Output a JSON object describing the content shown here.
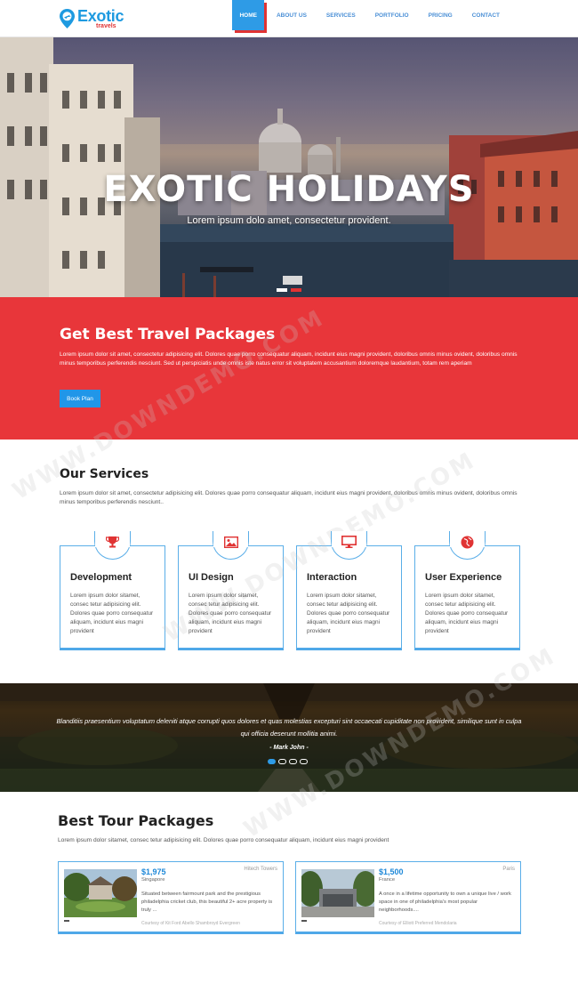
{
  "brand": {
    "name": "Exotic",
    "sub": "travels",
    "color": "#1e9ae0",
    "accent": "#e03333"
  },
  "nav": {
    "items": [
      {
        "label": "HOME",
        "active": true
      },
      {
        "label": "ABOUT US",
        "active": false
      },
      {
        "label": "SERVICES",
        "active": false
      },
      {
        "label": "PORTFOLIO",
        "active": false
      },
      {
        "label": "PRICING",
        "active": false
      },
      {
        "label": "CONTACT",
        "active": false
      }
    ]
  },
  "hero": {
    "title": "EXOTIC HOLIDAYS",
    "subtitle": "Lorem ipsum dolo amet, consectetur provident.",
    "slides": 2,
    "active_slide": 1
  },
  "packages_band": {
    "title": "Get Best Travel Packages",
    "text": "Lorem ipsum dolor sit amet, consectetur adipisicing elit. Dolores quae porro consequatur aliquam, incidunt eius magni provident, doloribus omnis minus ovident, doloribus omnis minus temporibus perferendis nesciunt. Sed ut perspiciatis unde omnis iste natus error sit voluptatem accusantium doloremque laudantium, totam rem aperiam",
    "button": "Book Plan",
    "color": "#e8363a"
  },
  "services": {
    "title": "Our Services",
    "text": "Lorem ipsum dolor sit amet, consectetur adipisicing elit. Dolores quae porro consequatur aliquam, incidunt eius magni provident, doloribus omnis minus ovident, doloribus omnis minus temporibus perferendis nesciunt..",
    "cards": [
      {
        "icon": "trophy-icon",
        "title": "Development",
        "text": "Lorem ipsum dolor sitamet, consec tetur adipisicing elit. Dolores quae porro consequatur aliquam, incidunt eius magni provident"
      },
      {
        "icon": "picture-icon",
        "title": "UI Design",
        "text": "Lorem ipsum dolor sitamet, consec tetur adipisicing elit. Dolores quae porro consequatur aliquam, incidunt eius magni provident"
      },
      {
        "icon": "monitor-icon",
        "title": "Interaction",
        "text": "Lorem ipsum dolor sitamet, consec tetur adipisicing elit. Dolores quae porro consequatur aliquam, incidunt eius magni provident"
      },
      {
        "icon": "globe-icon",
        "title": "User Experience",
        "text": "Lorem ipsum dolor sitamet, consec tetur adipisicing elit. Dolores quae porro consequatur aliquam, incidunt eius magni provident"
      }
    ]
  },
  "testimonial": {
    "quote": "Blanditiis praesentium voluptatum deleniti atque corrupti quos dolores et quas molestias excepturi sint occaecati cupiditate non provident, similique sunt in culpa qui officia deserunt mollitia animi.",
    "author": "- Mark John -",
    "dots": 4,
    "active_dot": 0
  },
  "tours": {
    "title": "Best Tour Packages",
    "text": "Lorem ipsum dolor sitamet, consec tetur adipisicing elit. Dolores quae porro consequatur aliquam, incidunt eius magni provident",
    "items": [
      {
        "price": "$1,975",
        "place": "Hitech Towers",
        "city": "Singapore",
        "desc": "Situated between fairmount park and the prestigious philadelphia cricket club, this beautiful 2+ acre property is truly ...",
        "credit": "Courtesy of Kit Ford Abello Shambroyd Evergreen"
      },
      {
        "price": "$1,500",
        "place": "Paris",
        "city": "France",
        "desc": "A once in a lifetime opportunity to own a unique live / work space in one of philadelphia's most popular neighborhoods....",
        "credit": "Courtesy of Elliott Preferred Mendolaria"
      }
    ]
  },
  "watermark": "WWW.DOWNDEMO.COM"
}
